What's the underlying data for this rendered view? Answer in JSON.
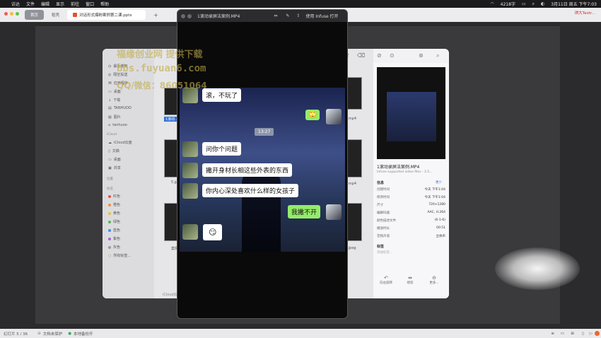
{
  "menubar": {
    "apple": "",
    "items": [
      "访达",
      "文件",
      "编辑",
      "显示",
      "前往",
      "窗口",
      "帮助"
    ],
    "status_keyboard": "4218字",
    "datetime": "3月11日 周五 下午7:03"
  },
  "tabbar": {
    "home": "首页",
    "docs": "稻壳",
    "active_doc": "对话形式爆粉案例第二课.pptx",
    "plus": "+",
    "right_user": "琪大Taotr..."
  },
  "video": {
    "title": "1滚动录屏法案例.MP4",
    "open_with": "使用 Infuse 打开",
    "time_pill": "13:27",
    "messages": [
      {
        "side": "left",
        "text": "滚，不玩了"
      },
      {
        "side": "right",
        "text": "🙄"
      },
      {
        "side": "left",
        "text": "问你个问题"
      },
      {
        "side": "left",
        "text": "撇开身材长相这些外表的东西"
      },
      {
        "side": "left",
        "text": "你内心深处喜欢什么样的女孩子"
      },
      {
        "side": "right",
        "text": "我撇不开"
      },
      {
        "side": "left",
        "text": "😏"
      }
    ]
  },
  "watermark": {
    "line1": "福缘创业网 提供下载",
    "line2": "bbs.fuyuan6.com",
    "line3": "QQ/微信：86051064"
  },
  "finder": {
    "sidebar": {
      "items": [
        "最近使用",
        "隔空投送",
        "应用程序",
        "桌面",
        "下载",
        "TANHUOO",
        "图片",
        "tanhuoo"
      ],
      "icloud_header": "iCloud",
      "icloud_items": [
        "iCloud云盘",
        "文稿",
        "桌面",
        "共享"
      ],
      "location_header": "位置",
      "tags_header": "标签",
      "tags": [
        {
          "name": "红色",
          "color": "#e5534b"
        },
        {
          "name": "橙色",
          "color": "#f0913c"
        },
        {
          "name": "黄色",
          "color": "#e8c23a"
        },
        {
          "name": "绿色",
          "color": "#5bb55b"
        },
        {
          "name": "蓝色",
          "color": "#3d8ee8"
        },
        {
          "name": "紫色",
          "color": "#a464d1"
        },
        {
          "name": "灰色",
          "color": "#9a9a9a"
        }
      ],
      "all_tags": "所有标签..."
    },
    "files": [
      "1滚动...",
      "2.mp4",
      "5.jp...",
      "4.mp4",
      "案例...",
      "1.jpeg"
    ],
    "footer_path": "iCloud云...",
    "info": {
      "filename": "1滚动录屏法案例.MP4",
      "kind": "Infuse supported video files - 3.5...",
      "info_header": "信息",
      "more": "更少",
      "rows": [
        {
          "k": "创建时间",
          "v": "今天 下午1:04"
        },
        {
          "k": "修改时间",
          "v": "今天 下午1:04"
        },
        {
          "k": "尺寸",
          "v": "720×1280"
        },
        {
          "k": "编解码器",
          "v": "AAC, H.264"
        },
        {
          "k": "颜色描述文件",
          "v": "(6-1-6)"
        },
        {
          "k": "播放时长",
          "v": "00:51"
        },
        {
          "k": "音频声道",
          "v": "立体声"
        }
      ],
      "tags_header": "标签",
      "add_tags": "添加标签...",
      "actions": [
        "向左旋转",
        "修剪",
        "更多..."
      ]
    }
  },
  "statusbar": {
    "slide": "幻灯片 5 / 36",
    "protect": "文档未保护",
    "backup": "本地备份开"
  }
}
